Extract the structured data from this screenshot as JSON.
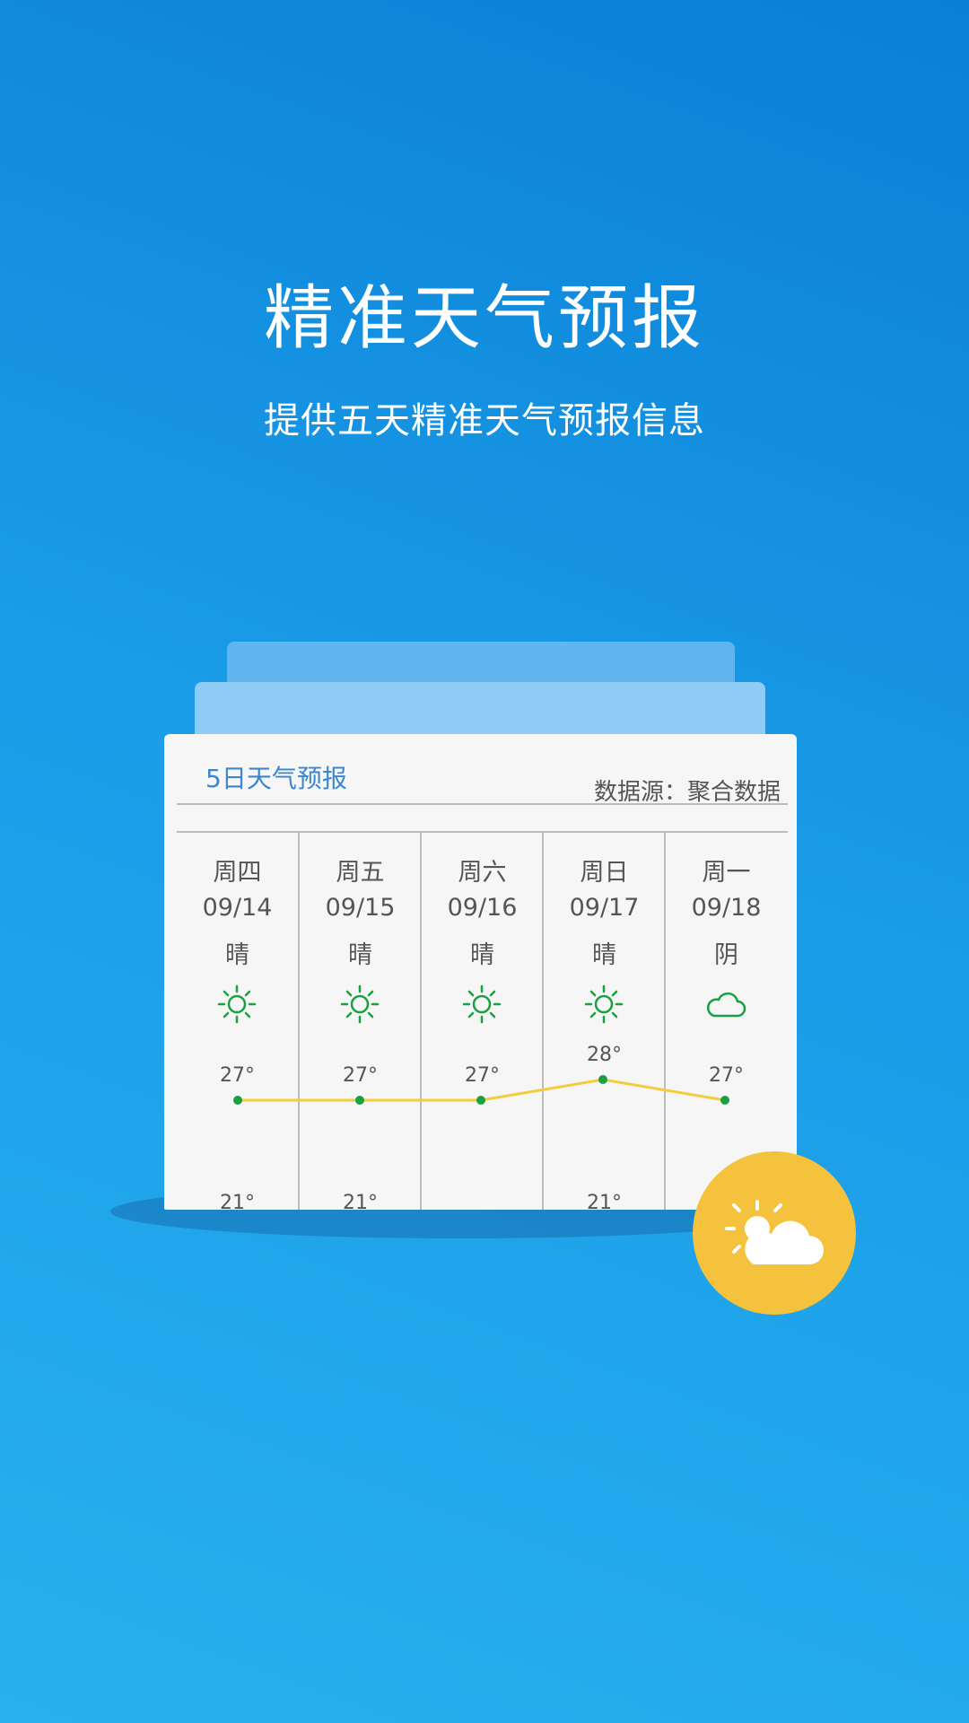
{
  "headline": {
    "title": "精准天气预报",
    "subtitle": "提供五天精准天气预报信息"
  },
  "card": {
    "title": "5日天气预报",
    "source": "数据源：聚合数据",
    "days": [
      {
        "day": "周四",
        "date": "09/14",
        "cond": "晴",
        "icon": "sun-icon",
        "high": "27°",
        "low": "21°"
      },
      {
        "day": "周五",
        "date": "09/15",
        "cond": "晴",
        "icon": "sun-icon",
        "high": "27°",
        "low": "21°"
      },
      {
        "day": "周六",
        "date": "09/16",
        "cond": "晴",
        "icon": "sun-icon",
        "high": "27°",
        "low": ""
      },
      {
        "day": "周日",
        "date": "09/17",
        "cond": "晴",
        "icon": "sun-icon",
        "high": "28°",
        "low": "21°"
      },
      {
        "day": "周一",
        "date": "09/18",
        "cond": "阴",
        "icon": "cloud-icon",
        "high": "27°",
        "low": ""
      }
    ],
    "high_values": [
      27,
      27,
      27,
      28,
      27
    ]
  },
  "colors": {
    "accent": "#3b86cf",
    "icon_green": "#1aa040",
    "line_yellow": "#f2cc3a",
    "badge": "#f5c23d"
  },
  "badge_icon": "partly-cloudy-icon"
}
